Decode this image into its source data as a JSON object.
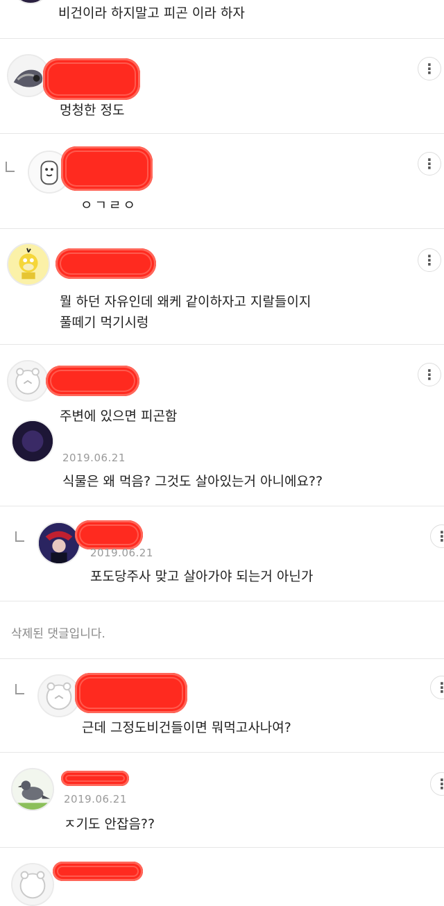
{
  "more_button_glyph": "⋮",
  "comments": [
    {
      "text": "비건이라 하지말고 피곤 이라 하자"
    },
    {
      "text": "멍청한 정도",
      "avatar": "fish-helmet-avatar-icon"
    },
    {
      "text": "ㅇㄱㄹㅇ",
      "avatar": "white-character-avatar-icon",
      "is_reply": true
    },
    {
      "text_lines": [
        "뭘 하던 자유인데 왜케 같이하자고 지랄들이지",
        "풀떼기 먹기시렁"
      ],
      "avatar": "psyduck-avatar-icon"
    },
    {
      "text": "주변에 있으면 피곤함",
      "avatar": "default-bear-avatar-icon"
    },
    {
      "date": "2019.06.21",
      "text": "식물은 왜 먹음? 그것도 살아있는거 아니에요??",
      "avatar": "dark-photo-avatar-icon"
    },
    {
      "date": "2019.06.21",
      "text": "포도당주사 맞고 살아가야 되는거 아닌가",
      "avatar": "dark-photo-avatar-icon",
      "is_reply": true
    },
    {
      "deleted_text": "삭제된 댓글입니다."
    },
    {
      "text": "근데 그정도비건들이면 뭐먹고사나여?",
      "avatar": "default-bear-avatar-icon",
      "is_reply": true
    },
    {
      "date": "2019.06.21",
      "text": "ㅈ기도 안잡음??",
      "avatar": "pigeon-avatar-icon"
    },
    {
      "avatar": "default-bear-avatar-icon"
    }
  ],
  "colors": {
    "redaction": "#ff2a1f",
    "divider": "#e6e6e6",
    "date": "#9a9a9a"
  }
}
